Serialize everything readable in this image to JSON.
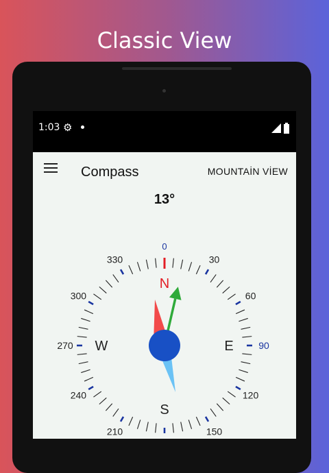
{
  "headline": "Classic View",
  "status": {
    "time": "1:03",
    "gear_icon": "⚙",
    "signal_icon": "◢",
    "battery_icon": "▮"
  },
  "appbar": {
    "title": "Compass",
    "location": "MOUNTAİN VİEW"
  },
  "heading": "13°",
  "compass": {
    "heading_degrees": 13,
    "cardinals": {
      "n": "N",
      "e": "E",
      "s": "S",
      "w": "W"
    },
    "degree_labels": {
      "d0": "0",
      "d30": "30",
      "d60": "60",
      "d90": "90",
      "d120": "120",
      "d150": "150",
      "d210": "210",
      "d240": "240",
      "d270": "270",
      "d300": "300",
      "d330": "330"
    },
    "colors": {
      "tick": "#222222",
      "major_tick": "#1a35a0",
      "north_red": "#e31e25",
      "needle_north": "#f24a4a",
      "needle_south": "#6bc2f5",
      "hub": "#1850c5",
      "arrow": "#2faa3a",
      "blue_label": "#1a35a0"
    }
  }
}
